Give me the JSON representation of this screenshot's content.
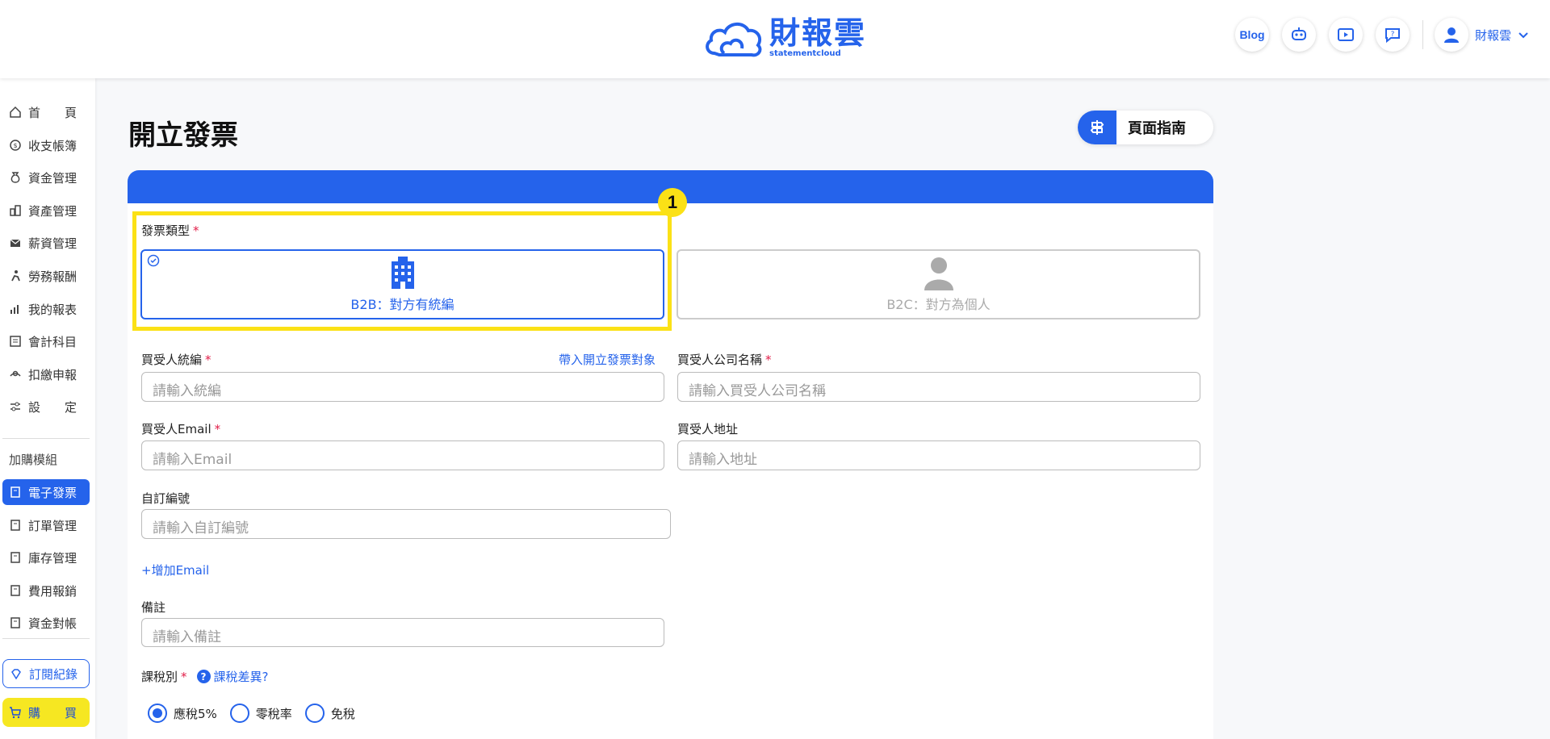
{
  "header": {
    "logo_main": "財報雲",
    "logo_sub": "statementcloud",
    "blog_label": "Blog",
    "user_name": "財報雲"
  },
  "sidebar": {
    "items": [
      {
        "label": "首　　頁",
        "icon": "home-icon"
      },
      {
        "label": "收支帳簿",
        "icon": "coin-icon"
      },
      {
        "label": "資金管理",
        "icon": "money-bag-icon"
      },
      {
        "label": "資產管理",
        "icon": "buildings-icon"
      },
      {
        "label": "薪資管理",
        "icon": "envelope-icon"
      },
      {
        "label": "勞務報酬",
        "icon": "worker-icon"
      },
      {
        "label": "我的報表",
        "icon": "bar-chart-icon"
      },
      {
        "label": "會計科目",
        "icon": "ledger-icon"
      },
      {
        "label": "扣繳申報",
        "icon": "hand-icon"
      },
      {
        "label": "設　　定",
        "icon": "settings-icon"
      }
    ],
    "addon_group_label": "加購模組",
    "addon_items": [
      {
        "label": "電子發票",
        "icon": "receipt-icon",
        "active": true
      },
      {
        "label": "訂單管理",
        "icon": "receipt-icon",
        "active": false
      },
      {
        "label": "庫存管理",
        "icon": "receipt-icon",
        "active": false
      },
      {
        "label": "費用報銷",
        "icon": "receipt-icon",
        "active": false
      },
      {
        "label": "資金對帳",
        "icon": "receipt-icon",
        "active": false
      }
    ],
    "subscription_label": "訂閱紀錄",
    "buy_label": "購　　買"
  },
  "page": {
    "title": "開立發票",
    "guide_label": "頁面指南"
  },
  "form": {
    "step_badge": "1",
    "invoice_type_label": "發票類型",
    "b2b_label": "B2B：對方有統編",
    "b2c_label": "B2C：對方為個人",
    "buyer_tax_id_label": "買受人統編",
    "bring_target_link": "帶入開立發票對象",
    "buyer_tax_id_placeholder": "請輸入統編",
    "buyer_company_label": "買受人公司名稱",
    "buyer_company_placeholder": "請輸入買受人公司名稱",
    "buyer_email_label": "買受人Email",
    "buyer_email_placeholder": "請輸入Email",
    "buyer_address_label": "買受人地址",
    "buyer_address_placeholder": "請輸入地址",
    "custom_no_label": "自訂編號",
    "custom_no_placeholder": "請輸入自訂編號",
    "add_email_link": "+增加Email",
    "remark_label": "備註",
    "remark_placeholder": "請輸入備註",
    "tax_type_label": "課稅別",
    "tax_diff_link": "課稅差異?",
    "tax_options": [
      "應稅5%",
      "零稅率",
      "免稅"
    ],
    "tax_selected": "應稅5%"
  },
  "colors": {
    "primary": "#2563eb",
    "highlight": "#fbe116",
    "required": "#e11d48"
  }
}
